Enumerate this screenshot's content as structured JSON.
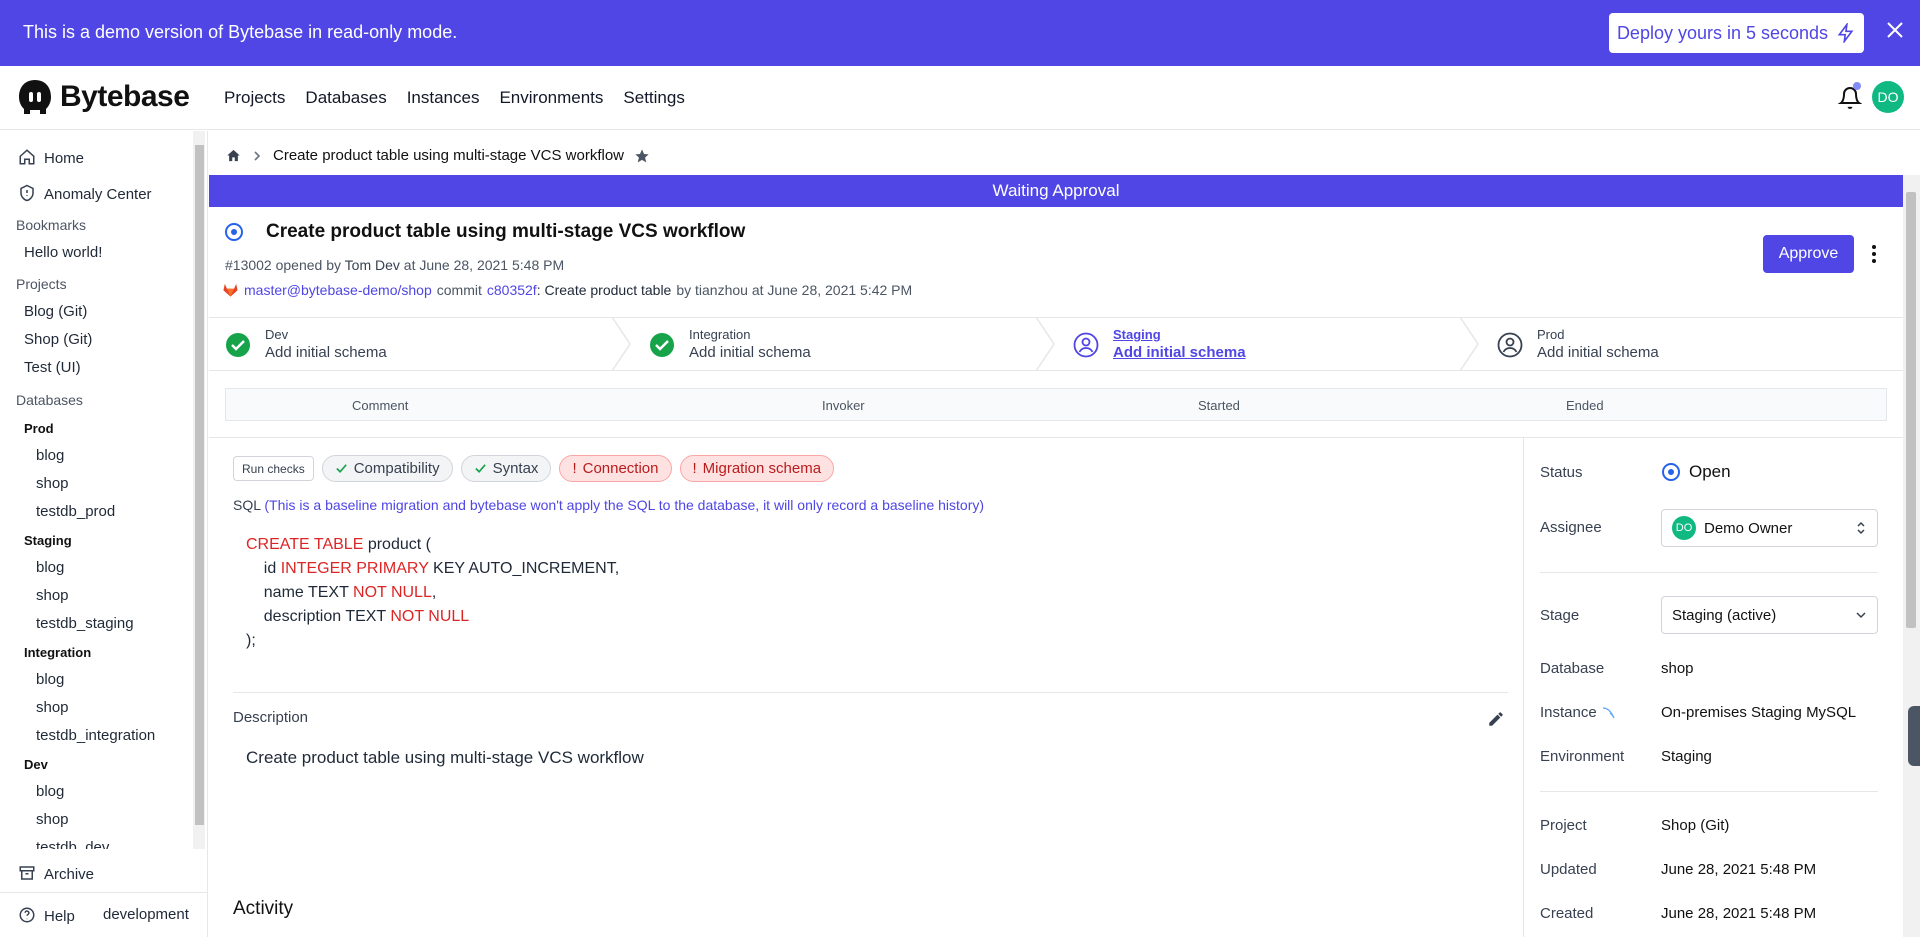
{
  "banner": {
    "text": "This is a demo version of Bytebase in read-only mode.",
    "deploy_label": "Deploy yours in 5 seconds",
    "bg_color": "#4f46e5"
  },
  "nav": {
    "logo_text": "Bytebase",
    "links": [
      "Projects",
      "Databases",
      "Instances",
      "Environments",
      "Settings"
    ],
    "avatar_initials": "DO"
  },
  "sidebar": {
    "home": "Home",
    "anomaly": "Anomaly Center",
    "bookmarks_title": "Bookmarks",
    "bookmarks": [
      "Hello world!"
    ],
    "projects_title": "Projects",
    "projects": [
      "Blog (Git)",
      "Shop (Git)",
      "Test (UI)"
    ],
    "databases_title": "Databases",
    "envs": [
      {
        "name": "Prod",
        "dbs": [
          "blog",
          "shop",
          "testdb_prod"
        ]
      },
      {
        "name": "Staging",
        "dbs": [
          "blog",
          "shop",
          "testdb_staging"
        ]
      },
      {
        "name": "Integration",
        "dbs": [
          "blog",
          "shop",
          "testdb_integration"
        ]
      },
      {
        "name": "Dev",
        "dbs": [
          "blog",
          "shop",
          "testdb_dev"
        ]
      }
    ],
    "archive": "Archive",
    "help": "Help",
    "mode": "development"
  },
  "breadcrumb": {
    "current": "Create product table using multi-stage VCS workflow"
  },
  "status_bar": "Waiting Approval",
  "issue": {
    "title": "Create product table using multi-stage VCS workflow",
    "number": "#13002",
    "opened_by_prefix": "opened by",
    "author": "Tom Dev",
    "opened_at": "at June 28, 2021 5:48 PM",
    "branch": "master@bytebase-demo/shop",
    "commit_word": "commit",
    "commit_hash": "c80352f",
    "commit_msg": ": Create product table",
    "commit_by": "by tianzhou at June 28, 2021 5:42 PM",
    "approve_label": "Approve"
  },
  "pipeline": [
    {
      "env": "Dev",
      "task": "Add initial schema",
      "state": "done"
    },
    {
      "env": "Integration",
      "task": "Add initial schema",
      "state": "done"
    },
    {
      "env": "Staging",
      "task": "Add initial schema",
      "state": "active"
    },
    {
      "env": "Prod",
      "task": "Add initial schema",
      "state": "pending"
    }
  ],
  "runs_table": {
    "columns": [
      "Comment",
      "Invoker",
      "Started",
      "Ended"
    ]
  },
  "checks": {
    "run_label": "Run checks",
    "items": [
      {
        "label": "Compatibility",
        "status": "ok"
      },
      {
        "label": "Syntax",
        "status": "ok"
      },
      {
        "label": "Connection",
        "status": "error"
      },
      {
        "label": "Migration schema",
        "status": "error"
      }
    ]
  },
  "sql": {
    "label": "SQL",
    "note": "(This is a baseline migration and bytebase won't apply the SQL to the database, it will only record a baseline history)"
  },
  "description": {
    "label": "Description",
    "text": "Create product table using multi-stage VCS workflow"
  },
  "activity_label": "Activity",
  "details": {
    "status_label": "Status",
    "status_value": "Open",
    "assignee_label": "Assignee",
    "assignee_value": "Demo Owner",
    "assignee_initials": "DO",
    "stage_label": "Stage",
    "stage_value": "Staging (active)",
    "database_label": "Database",
    "database_value": "shop",
    "instance_label": "Instance",
    "instance_value": "On-premises Staging MySQL",
    "environment_label": "Environment",
    "environment_value": "Staging",
    "project_label": "Project",
    "project_value": "Shop (Git)",
    "updated_label": "Updated",
    "updated_value": "June 28, 2021 5:48 PM",
    "created_label": "Created",
    "created_value": "June 28, 2021 5:48 PM"
  }
}
